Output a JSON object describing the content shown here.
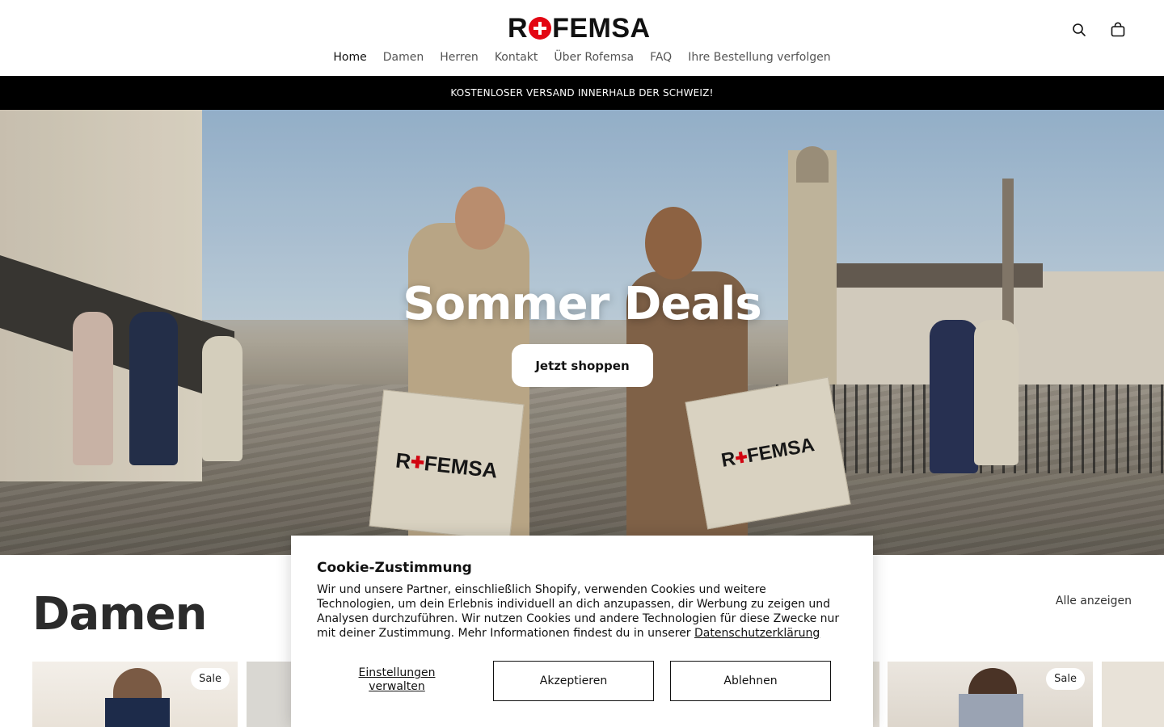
{
  "brand": {
    "logo_left": "R",
    "logo_right": "FEMSA"
  },
  "header": {
    "search_icon": "search-icon",
    "cart_icon": "shopping-bag-icon"
  },
  "nav": {
    "items": [
      {
        "label": "Home"
      },
      {
        "label": "Damen"
      },
      {
        "label": "Herren"
      },
      {
        "label": "Kontakt"
      },
      {
        "label": "Über Rofemsa"
      },
      {
        "label": "FAQ"
      },
      {
        "label": "Ihre Bestellung verfolgen"
      }
    ]
  },
  "announcement": {
    "text": "KOSTENLOSER VERSAND INNERHALB DER SCHWEIZ!"
  },
  "hero": {
    "title": "Sommer Deals",
    "button": "Jetzt shoppen",
    "bag_left_brand": "R",
    "bag_left_brand_rest": "FEMSA",
    "bag_right_brand": "R",
    "bag_right_brand_rest": "FEMSA"
  },
  "collection": {
    "title": "Damen",
    "view_all": "Alle anzeigen",
    "cards": [
      {
        "badge": "Sale"
      },
      {
        "badge": ""
      },
      {
        "badge": ""
      },
      {
        "badge": "Sale"
      }
    ]
  },
  "cookie": {
    "title": "Cookie-Zustimmung",
    "text": "Wir und unsere Partner, einschließlich Shopify, verwenden Cookies und weitere Technologien, um dein Erlebnis individuell an dich anzupassen, dir Werbung zu zeigen und Analysen durchzuführen. Wir nutzen Cookies und andere Technologien für diese Zwecke nur mit deiner Zustimmung. Mehr Informationen findest du in unserer ",
    "link": "Datenschutzerklärung",
    "manage": "Einstellungen verwalten",
    "accept": "Akzeptieren",
    "decline": "Ablehnen"
  },
  "colors": {
    "accent_red": "#e30613",
    "bar_black": "#000000"
  }
}
